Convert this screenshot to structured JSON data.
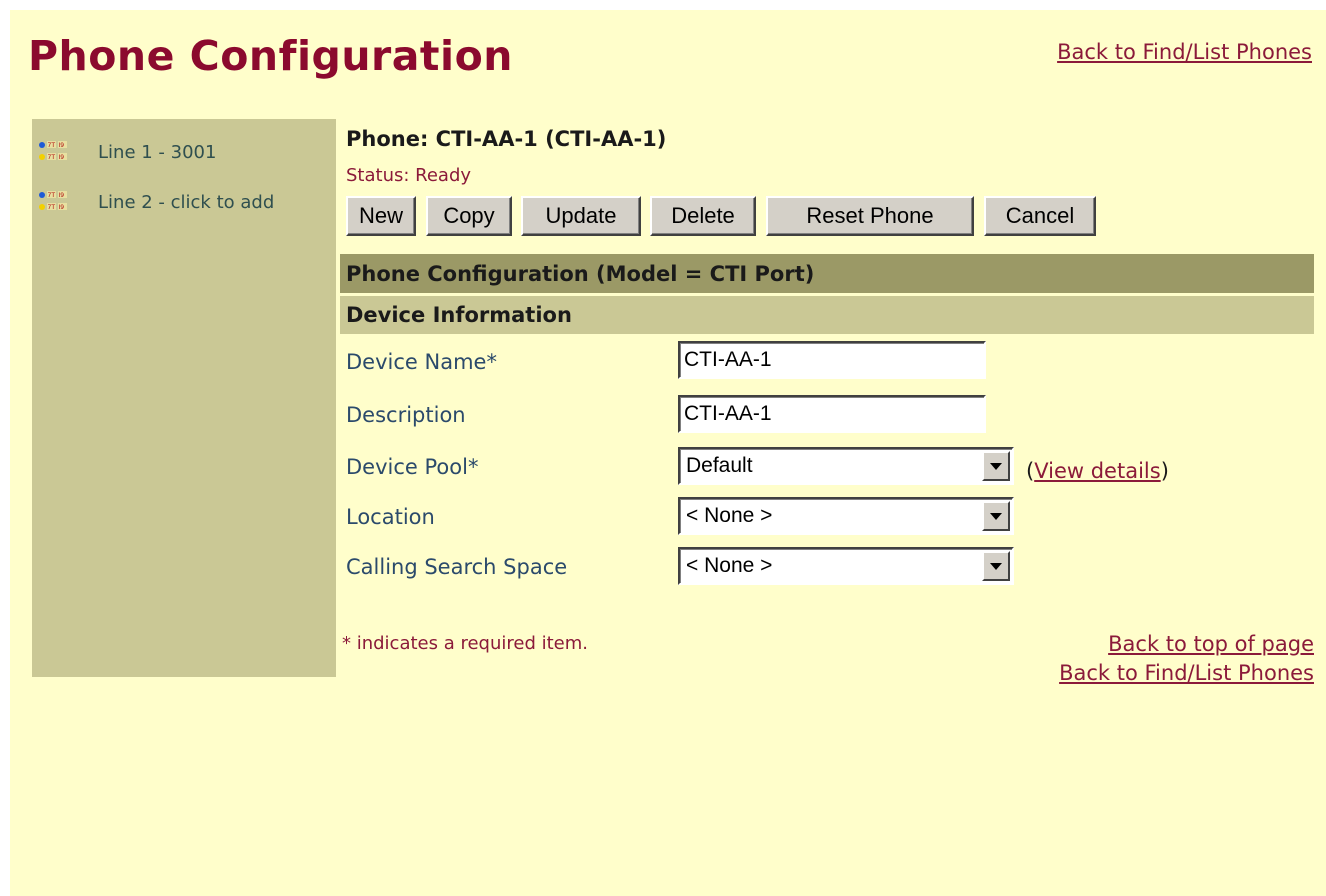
{
  "header": {
    "title": "Phone Configuration",
    "back_link": "Back to Find/List Phones"
  },
  "sidebar": {
    "items": [
      {
        "label": "Line 1 - 3001",
        "icon": "phone-line-icon"
      },
      {
        "label": "Line 2 - click to add",
        "icon": "phone-line-icon"
      }
    ]
  },
  "main": {
    "phone_label": "Phone:  CTI-AA-1 (CTI-AA-1)",
    "status": "Status: Ready",
    "buttons": {
      "new": "New",
      "copy": "Copy",
      "update": "Update",
      "delete": "Delete",
      "reset": "Reset Phone",
      "cancel": "Cancel"
    },
    "section_title": "Phone Configuration (Model = CTI Port)",
    "subsection_title": "Device Information",
    "fields": {
      "device_name": {
        "label": "Device Name*",
        "value": "CTI-AA-1"
      },
      "description": {
        "label": "Description",
        "value": "CTI-AA-1"
      },
      "device_pool": {
        "label": "Device Pool*",
        "value": "Default"
      },
      "location": {
        "label": "Location",
        "value": "< None >"
      },
      "css": {
        "label": "Calling Search Space",
        "value": "< None >"
      }
    },
    "view_details": {
      "open": "(",
      "link": "View details",
      "close": ")"
    },
    "required_note": "* indicates a required item.",
    "back_top": "Back to top of page",
    "back_find": "Back to Find/List Phones"
  },
  "colors": {
    "page_bg": "#fffecb",
    "title": "#8b0a2e",
    "sidebar_bg": "#cac895",
    "section_bar": "#9b9966",
    "subsection_bar": "#cac895",
    "label": "#2b4a6b",
    "link": "#8b1a3a"
  }
}
